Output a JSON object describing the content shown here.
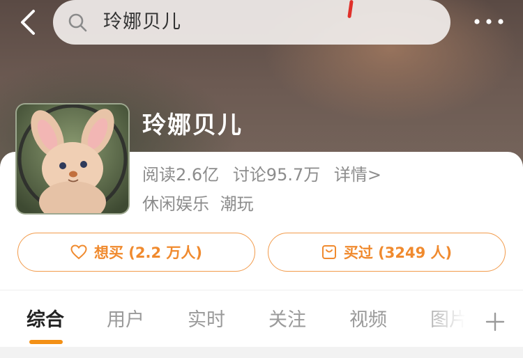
{
  "header": {
    "back_icon": "chevron-left-icon",
    "search": {
      "text": "玲娜贝儿",
      "icon": "search-icon"
    },
    "more_icon": "more-dots-icon"
  },
  "topic": {
    "title": "玲娜贝儿",
    "stats": {
      "reads": "阅读2.6亿",
      "discussions": "讨论95.7万",
      "details": "详情>"
    },
    "tags": [
      "休闲娱乐",
      "潮玩"
    ]
  },
  "actions": {
    "want": {
      "label": "想买 (2.2 万人)",
      "icon": "heart-icon"
    },
    "bought": {
      "label": "买过 (3249 人)",
      "icon": "shopping-bag-icon"
    }
  },
  "tabs": {
    "items": [
      "综合",
      "用户",
      "实时",
      "关注",
      "视频",
      "图片"
    ],
    "active": "综合",
    "add_icon": "plus-icon"
  },
  "colors": {
    "accent": "#f39016",
    "button_border": "#f29a4a",
    "button_text": "#f08a2e",
    "muted_text": "#8c8c8c"
  }
}
